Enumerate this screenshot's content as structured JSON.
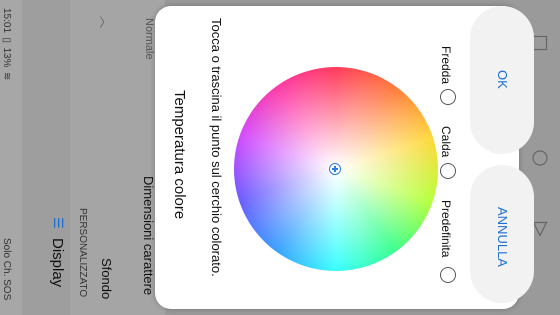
{
  "status_bar": {
    "carrier": "Solo Ch. SOS",
    "battery": "13%",
    "time": "15:01"
  },
  "app_bar": {
    "menu_icon": "hamburger-icon",
    "title": "Display"
  },
  "settings": {
    "section_header": "PERSONALIZZATO",
    "items": [
      {
        "label": "Sfondo"
      },
      {
        "label": "Dimensioni carattere",
        "value": "Normale"
      }
    ]
  },
  "dialog": {
    "title": "Temperatura colore",
    "instruction": "Tocca o trascina il punto sul cerchio colorato.",
    "options": [
      {
        "label": "Predefinita",
        "selected": false
      },
      {
        "label": "Calda",
        "selected": false
      },
      {
        "label": "Fredda",
        "selected": false
      }
    ],
    "cancel_label": "ANNULLA",
    "ok_label": "OK"
  },
  "nav_icons": [
    "back-icon",
    "home-icon",
    "recents-icon"
  ],
  "colors": {
    "accent": "#1f6fd1",
    "dialog_bg": "#ffffff"
  }
}
